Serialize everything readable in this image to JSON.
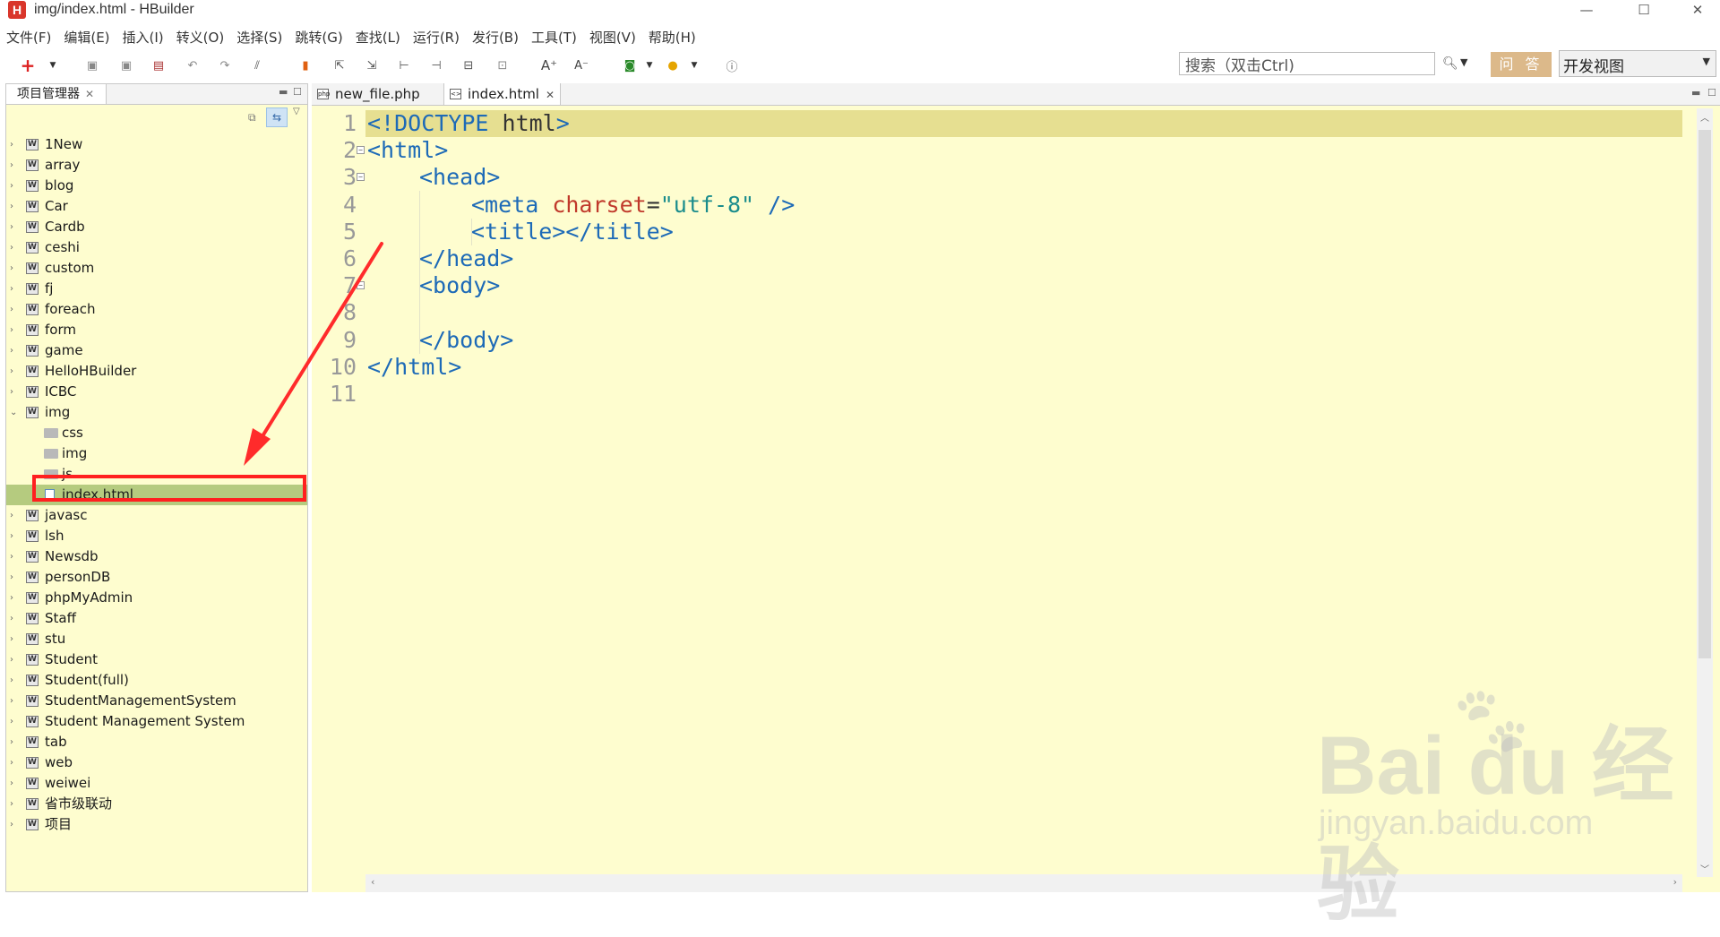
{
  "window": {
    "title": "img/index.html - HBuilder",
    "logo_letter": "H"
  },
  "menu": [
    "文件(F)",
    "编辑(E)",
    "插入(I)",
    "转义(O)",
    "选择(S)",
    "跳转(G)",
    "查找(L)",
    "运行(R)",
    "发行(B)",
    "工具(T)",
    "视图(V)",
    "帮助(H)"
  ],
  "toolbar": {
    "search_placeholder": "搜索（双击Ctrl)",
    "ask_label": "问 答",
    "view_mode": "开发视图"
  },
  "project_panel": {
    "tab_label": "项目管理器",
    "projects_before": [
      "1New",
      "array",
      "blog",
      "Car",
      "Cardb",
      "ceshi",
      "custom",
      "fj",
      "foreach",
      "form",
      "game",
      "HelloHBuilder",
      "ICBC"
    ],
    "expanded_project": "img",
    "children": [
      "css",
      "img",
      "js"
    ],
    "selected_file": "index.html",
    "projects_after": [
      "javasc",
      "lsh",
      "Newsdb",
      "personDB",
      "phpMyAdmin",
      "Staff",
      "stu",
      "Student",
      "Student(full)",
      "StudentManagementSystem",
      "Student Management System",
      "tab",
      "web",
      "weiwei",
      "省市级联动",
      "项目"
    ]
  },
  "editor": {
    "tabs": [
      {
        "label": "new_file.php",
        "icon": "php-file-icon"
      },
      {
        "label": "index.html",
        "icon": "html-file-icon"
      }
    ],
    "line_numbers": [
      "1",
      "2",
      "3",
      "4",
      "5",
      "6",
      "7",
      "8",
      "9",
      "10",
      "11"
    ],
    "lines": [
      {
        "indent": 0,
        "parts": [
          [
            "tag",
            "<!DOCTYPE"
          ],
          [
            "plain",
            " html"
          ],
          [
            "tag",
            ">"
          ]
        ]
      },
      {
        "indent": 0,
        "parts": [
          [
            "tag",
            "<html>"
          ]
        ]
      },
      {
        "indent": 1,
        "parts": [
          [
            "tag",
            "<head>"
          ]
        ]
      },
      {
        "indent": 2,
        "parts": [
          [
            "tag",
            "<meta"
          ],
          [
            "plain",
            " "
          ],
          [
            "attr",
            "charset"
          ],
          [
            "plain",
            "="
          ],
          [
            "str",
            "\"utf-8\""
          ],
          [
            "plain",
            " "
          ],
          [
            "tag",
            "/>"
          ]
        ]
      },
      {
        "indent": 2,
        "parts": [
          [
            "tag",
            "<title></title>"
          ]
        ]
      },
      {
        "indent": 1,
        "parts": [
          [
            "tag",
            "</head>"
          ]
        ]
      },
      {
        "indent": 1,
        "parts": [
          [
            "tag",
            "<body>"
          ]
        ]
      },
      {
        "indent": 1,
        "parts": []
      },
      {
        "indent": 1,
        "parts": [
          [
            "tag",
            "</body>"
          ]
        ]
      },
      {
        "indent": 0,
        "parts": [
          [
            "tag",
            "</html>"
          ]
        ]
      },
      {
        "indent": 0,
        "parts": []
      }
    ]
  },
  "colors": {
    "editor_bg": "#fefdcf",
    "current_line": "#e6df91",
    "selection": "#b5cb7f",
    "annotation_red": "#ff2020",
    "tag": "#1d6ab7",
    "attr": "#c0392b",
    "string": "#1a8c8c"
  },
  "watermark": {
    "brand": "Bai du 经验",
    "url": "jingyan.baidu.com"
  }
}
